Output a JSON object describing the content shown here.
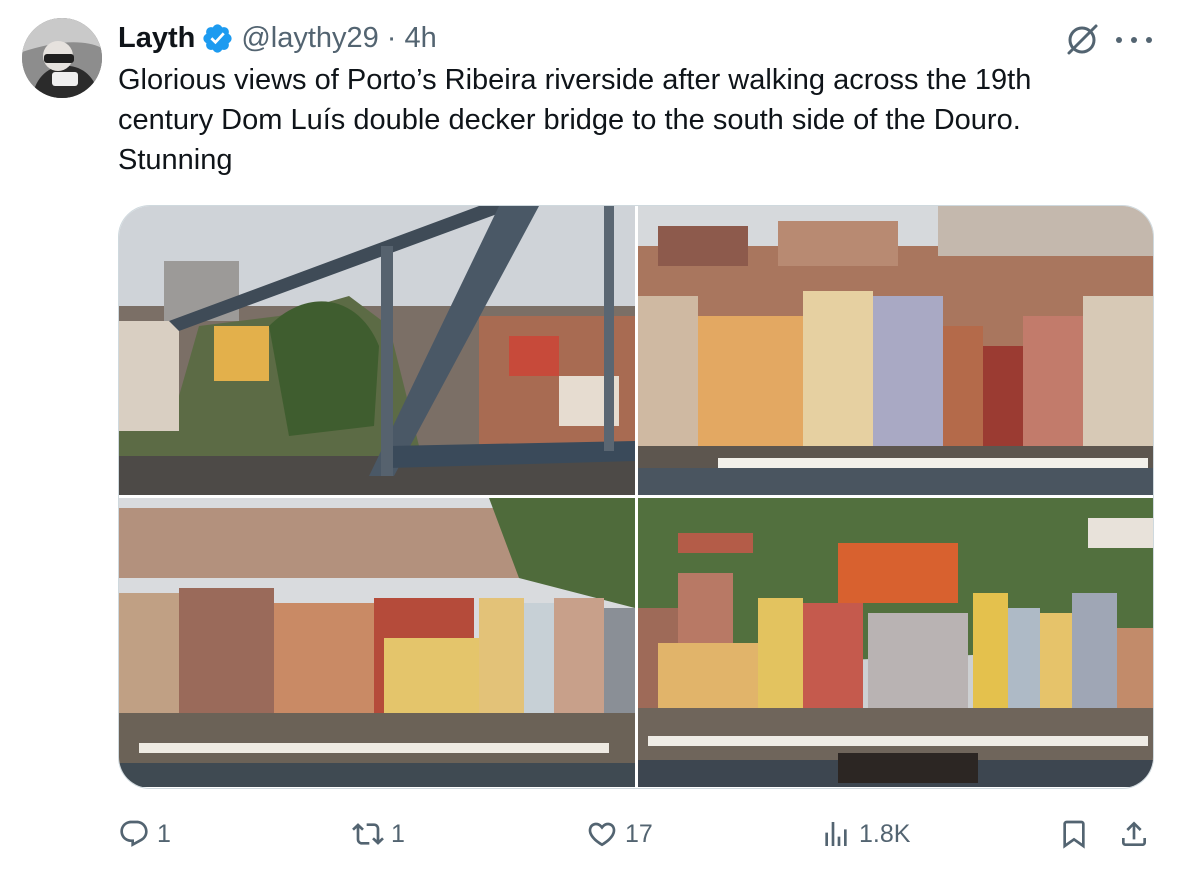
{
  "tweet": {
    "author_name": "Layth",
    "handle": "@laythy29",
    "separator": "·",
    "time": "4h",
    "text": "Glorious views of Porto’s Ribeira riverside after walking across the 19th century Dom Luís double decker bridge to the south side of the Douro. Stunning"
  },
  "actions": {
    "replies": "1",
    "reposts": "1",
    "likes": "17",
    "views": "1.8K"
  },
  "icons": {
    "verified": "verified-badge-icon",
    "grok": "grok-icon",
    "more": "more-icon",
    "reply": "reply-icon",
    "repost": "repost-icon",
    "like": "heart-icon",
    "views": "views-chart-icon",
    "bookmark": "bookmark-icon",
    "share": "share-icon"
  },
  "colors": {
    "text": "#0f1419",
    "secondary": "#536471",
    "verified": "#1d9bf0",
    "border": "#cfd9de"
  }
}
